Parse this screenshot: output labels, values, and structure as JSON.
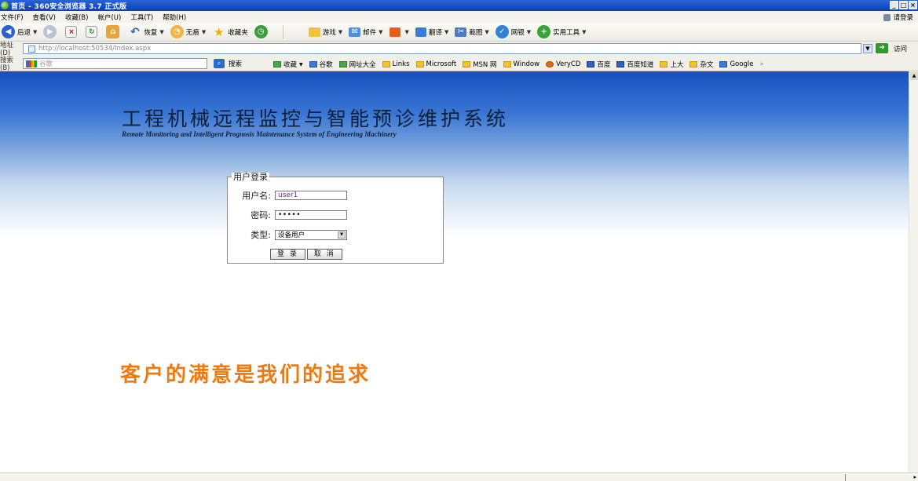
{
  "window": {
    "title": "首页 - 360安全浏览器 3.7 正式版",
    "min_icon": "_",
    "max_icon": "□",
    "close_icon": "×"
  },
  "menu": {
    "items": [
      "文件(F)",
      "查看(V)",
      "收藏(B)",
      "帐户(U)",
      "工具(T)",
      "帮助(H)"
    ],
    "login": "请登录"
  },
  "toolbar": {
    "back": "后退",
    "restore": "恢复",
    "no_trace": "无痕",
    "favorites": "收藏夹",
    "game": "游戏",
    "mail": "邮件",
    "translate": "翻译",
    "screenshot": "截图",
    "online_bank": "网银",
    "tools": "实用工具"
  },
  "address": {
    "label": "地址(D)",
    "url": "http://localhost:50534/Index.aspx",
    "go_label": "访问"
  },
  "search": {
    "label": "搜索(B)",
    "placeholder": "谷歌",
    "button": "搜索"
  },
  "links": {
    "items": [
      "收藏",
      "谷歌",
      "网址大全",
      "Links",
      "Microsoft",
      "MSN 网",
      "Window",
      "VeryCD",
      "百度",
      "百度知道",
      "上大",
      "杂文",
      "Google"
    ],
    "more": "»"
  },
  "page": {
    "title": "工程机械远程监控与智能预诊维护系统",
    "subtitle": "Remote Monitoring and Intelligent Prognosis Maintenance System of Engineering Machinery",
    "slogan": "客户的满意是我们的追求"
  },
  "login": {
    "legend": "用户登录",
    "username_label": "用户名:",
    "username_value": "user1",
    "password_label": "密码:",
    "password_mask": "•••••",
    "type_label": "类型:",
    "type_value": "设备用户",
    "submit": "登 录",
    "cancel": "取 消"
  }
}
